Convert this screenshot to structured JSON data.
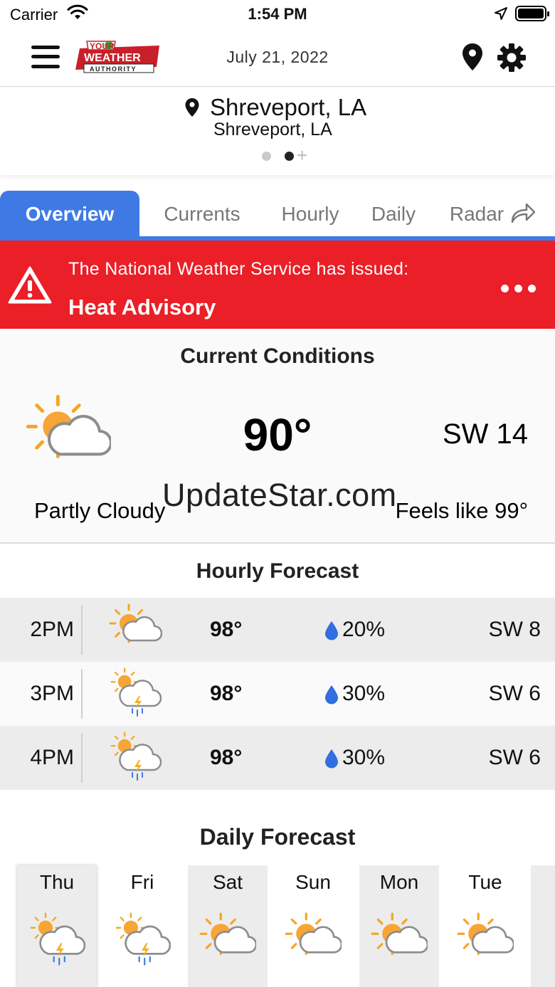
{
  "status_bar": {
    "carrier": "Carrier",
    "time": "1:54 PM"
  },
  "nav": {
    "date": "July 21, 2022",
    "logo_text": [
      "YOUR",
      "WEATHER",
      "AUTHORITY"
    ]
  },
  "location": {
    "city": "Shreveport, LA",
    "subtitle": "Shreveport, LA",
    "page_count": 2,
    "active_page": 2
  },
  "tabs": [
    {
      "label": "Overview",
      "active": true
    },
    {
      "label": "Currents",
      "active": false
    },
    {
      "label": "Hourly",
      "active": false
    },
    {
      "label": "Daily",
      "active": false
    },
    {
      "label": "Radar",
      "active": false
    }
  ],
  "alert": {
    "issued_text": "The National Weather Service has issued:",
    "title": "Heat Advisory",
    "color": "#ea1f27"
  },
  "current": {
    "heading": "Current Conditions",
    "temperature": "90°",
    "wind": "SW 14",
    "condition": "Partly Cloudy",
    "feels_like": "Feels like 99°",
    "icon": "partly-cloudy-icon"
  },
  "watermark": "UpdateStar.com",
  "hourly": {
    "heading": "Hourly Forecast",
    "rows": [
      {
        "hour": "2PM",
        "temp": "98°",
        "precip": "20%",
        "wind": "SW 8",
        "icon": "partly-cloudy-icon"
      },
      {
        "hour": "3PM",
        "temp": "98°",
        "precip": "30%",
        "wind": "SW 6",
        "icon": "thunderstorm-icon"
      },
      {
        "hour": "4PM",
        "temp": "98°",
        "precip": "30%",
        "wind": "SW 6",
        "icon": "thunderstorm-icon"
      }
    ]
  },
  "daily": {
    "heading": "Daily Forecast",
    "days": [
      {
        "day": "Thu",
        "icon": "thunderstorm-icon",
        "selected": true
      },
      {
        "day": "Fri",
        "icon": "thunderstorm-icon",
        "selected": false
      },
      {
        "day": "Sat",
        "icon": "partly-cloudy-icon",
        "selected": false
      },
      {
        "day": "Sun",
        "icon": "partly-cloudy-icon",
        "selected": false
      },
      {
        "day": "Mon",
        "icon": "partly-cloudy-icon",
        "selected": false
      },
      {
        "day": "Tue",
        "icon": "partly-cloudy-icon",
        "selected": false
      }
    ]
  },
  "colors": {
    "accent": "#3f7ae4",
    "sun": "#f5a623",
    "drop": "#2f6fe0"
  }
}
